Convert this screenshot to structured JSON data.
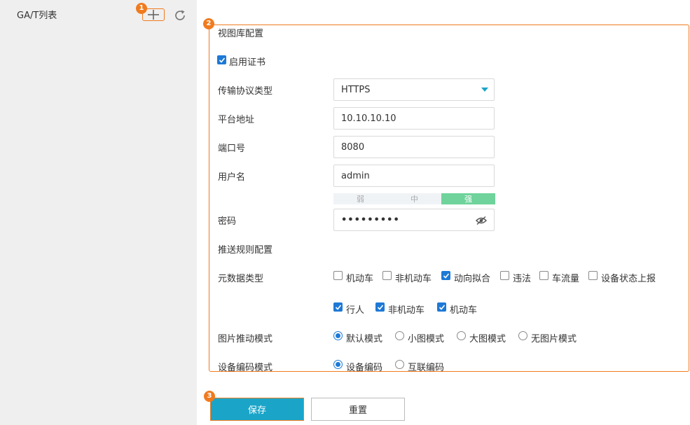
{
  "sidebar": {
    "title": "GA/T列表",
    "add_icon": "plus-icon",
    "refresh_icon": "refresh-icon"
  },
  "markers": [
    "1",
    "2",
    "3"
  ],
  "form": {
    "section_view_library": "视图库配置",
    "enable_cert_label": "启用证书",
    "enable_cert_checked": true,
    "protocol_label": "传输协议类型",
    "protocol_value": "HTTPS",
    "address_label": "平台地址",
    "address_value": "10.10.10.10",
    "port_label": "端口号",
    "port_value": "8080",
    "username_label": "用户名",
    "username_value": "admin",
    "strength": {
      "weak": "弱",
      "medium": "中",
      "strong": "强",
      "level": "strong"
    },
    "password_label": "密码",
    "password_value": "•••••••••",
    "section_push_rules": "推送规则配置",
    "metadata_label": "元数据类型",
    "metadata_options_row1": [
      {
        "label": "机动车",
        "checked": false
      },
      {
        "label": "非机动车",
        "checked": false
      },
      {
        "label": "动向拟合",
        "checked": true
      },
      {
        "label": "违法",
        "checked": false
      },
      {
        "label": "车流量",
        "checked": false
      },
      {
        "label": "设备状态上报",
        "checked": false
      }
    ],
    "metadata_options_row2": [
      {
        "label": "行人",
        "checked": true
      },
      {
        "label": "非机动车",
        "checked": true
      },
      {
        "label": "机动车",
        "checked": true
      }
    ],
    "image_push_label": "图片推动模式",
    "image_push_options": [
      {
        "label": "默认模式",
        "checked": true
      },
      {
        "label": "小图模式",
        "checked": false
      },
      {
        "label": "大图模式",
        "checked": false
      },
      {
        "label": "无图片模式",
        "checked": false
      }
    ],
    "device_code_label": "设备编码模式",
    "device_code_options": [
      {
        "label": "设备编码",
        "checked": true
      },
      {
        "label": "互联编码",
        "checked": false
      }
    ]
  },
  "buttons": {
    "save": "保存",
    "reset": "重置"
  },
  "colors": {
    "accent": "#1aa5c8",
    "highlight": "#f07b1f",
    "check": "#1d79d6",
    "strength_strong": "#6fd39b"
  }
}
